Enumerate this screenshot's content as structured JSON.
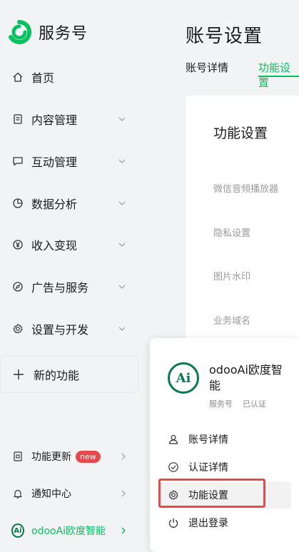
{
  "brand": {
    "name": "服务号"
  },
  "nav": [
    {
      "label": "首页",
      "icon": "home-icon"
    },
    {
      "label": "内容管理",
      "icon": "document-icon"
    },
    {
      "label": "互动管理",
      "icon": "chat-bubble-icon"
    },
    {
      "label": "数据分析",
      "icon": "pie-chart-icon"
    },
    {
      "label": "收入变现",
      "icon": "yen-icon"
    },
    {
      "label": "广告与服务",
      "icon": "compass-icon"
    },
    {
      "label": "设置与开发",
      "icon": "gear-icon"
    }
  ],
  "new_feature": {
    "label": "新的功能"
  },
  "bottom": {
    "updates": {
      "label": "功能更新",
      "badge": "new"
    },
    "notifications": {
      "label": "通知中心"
    },
    "account": {
      "label": "odooAi欧度智能",
      "avatar_text": "Ai"
    }
  },
  "main": {
    "title": "账号设置",
    "tabs": [
      {
        "label": "账号详情",
        "active": false
      },
      {
        "label": "功能设置",
        "active": true
      }
    ],
    "card_title": "功能设置",
    "settings": [
      "微信音频播放器",
      "隐私设置",
      "图片水印",
      "业务域名"
    ]
  },
  "popup": {
    "avatar_text": "Ai",
    "name": "odooAi欧度智能",
    "type": "服务号",
    "verified": "已认证",
    "items": [
      {
        "label": "账号详情",
        "icon": "user-icon"
      },
      {
        "label": "认证详情",
        "icon": "check-circle-icon"
      },
      {
        "label": "功能设置",
        "icon": "gear-icon"
      },
      {
        "label": "退出登录",
        "icon": "power-icon"
      }
    ]
  },
  "colors": {
    "accent": "#07c160",
    "highlight": "#e5484d",
    "brand_dark_green": "#0b7a4b"
  }
}
